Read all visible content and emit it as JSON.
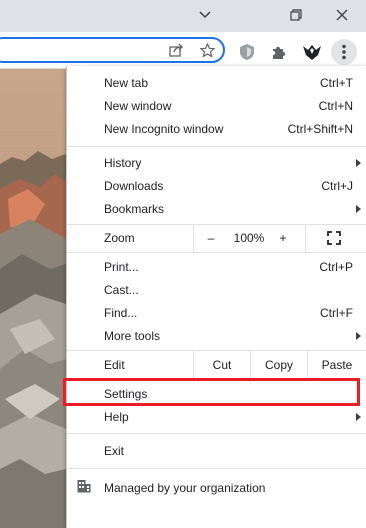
{
  "window": {
    "minimize_glyph": "⌄",
    "restore_glyph": "❐",
    "close_glyph": "✕"
  },
  "toolbar": {
    "share_icon": "share-icon",
    "bookmark_icon": "star-icon",
    "extensions": [
      "shield-extension-icon",
      "puzzle-extensions-icon",
      "eagle-extension-icon"
    ],
    "menu_icon": "kebab-menu-icon"
  },
  "menu": {
    "new_tab": {
      "label": "New tab",
      "shortcut": "Ctrl+T"
    },
    "new_window": {
      "label": "New window",
      "shortcut": "Ctrl+N"
    },
    "new_incognito": {
      "label": "New Incognito window",
      "shortcut": "Ctrl+Shift+N"
    },
    "history": {
      "label": "History"
    },
    "downloads": {
      "label": "Downloads",
      "shortcut": "Ctrl+J"
    },
    "bookmarks": {
      "label": "Bookmarks"
    },
    "zoom": {
      "label": "Zoom",
      "minus": "–",
      "level": "100%",
      "plus": "+",
      "fullscreen_icon": "fullscreen-icon"
    },
    "print": {
      "label": "Print...",
      "shortcut": "Ctrl+P"
    },
    "cast": {
      "label": "Cast..."
    },
    "find": {
      "label": "Find...",
      "shortcut": "Ctrl+F"
    },
    "more_tools": {
      "label": "More tools"
    },
    "edit": {
      "label": "Edit",
      "cut": "Cut",
      "copy": "Copy",
      "paste": "Paste"
    },
    "settings": {
      "label": "Settings"
    },
    "help": {
      "label": "Help"
    },
    "exit": {
      "label": "Exit"
    },
    "managed": {
      "label": "Managed by your organization",
      "icon": "building-icon"
    }
  },
  "colors": {
    "highlight": "#ee1c24",
    "omnibox_border": "#1a73e8"
  }
}
